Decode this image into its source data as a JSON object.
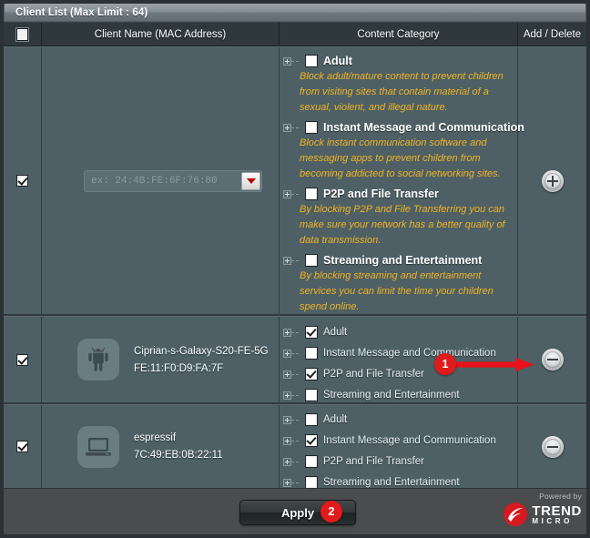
{
  "titlebar": {
    "title": "Client List (Max Limit : 64)"
  },
  "table": {
    "headers": {
      "select_all": "select-all-checkbox",
      "client_name": "Client Name (MAC Address)",
      "content_category": "Content Category",
      "add_delete": "Add / Delete"
    }
  },
  "new_row": {
    "row_checked": true,
    "mac_placeholder": "ex: 24:4B:FE:6F:76:80",
    "mac_value": "",
    "dropdown_icon": "caret-down-icon",
    "action_icon": "plus-circle-icon",
    "categories": [
      {
        "label": "Adult",
        "checked": false,
        "description": "Block adult/mature content to prevent children from visiting sites that contain material of a sexual, violent, and illegal nature."
      },
      {
        "label": "Instant Message and Communication",
        "checked": false,
        "description": "Block instant communication software and messaging apps to prevent children from becoming addicted to social networking sites."
      },
      {
        "label": "P2P and File Transfer",
        "checked": false,
        "description": "By blocking P2P and File Transferring you can make sure your network has a better quality of data transmission."
      },
      {
        "label": "Streaming and Entertainment",
        "checked": false,
        "description": "By blocking streaming and entertainment services you can limit the time your children spend online."
      }
    ]
  },
  "clients": [
    {
      "row_checked": true,
      "device_icon": "android-robot-icon",
      "name": "Ciprian-s-Galaxy-S20-FE-5G",
      "mac": "FE:11:F0:D9:FA:7F",
      "action_icon": "minus-circle-icon",
      "categories": [
        {
          "label": "Adult",
          "checked": true
        },
        {
          "label": "Instant Message and Communication",
          "checked": false
        },
        {
          "label": "P2P and File Transfer",
          "checked": true
        },
        {
          "label": "Streaming and Entertainment",
          "checked": false
        }
      ]
    },
    {
      "row_checked": true,
      "device_icon": "laptop-icon",
      "name": "espressif",
      "mac": "7C:49:EB:0B:22:11",
      "action_icon": "minus-circle-icon",
      "categories": [
        {
          "label": "Adult",
          "checked": false
        },
        {
          "label": "Instant Message and Communication",
          "checked": true
        },
        {
          "label": "P2P and File Transfer",
          "checked": false
        },
        {
          "label": "Streaming and Entertainment",
          "checked": false
        }
      ]
    }
  ],
  "footer": {
    "apply_label": "Apply",
    "powered_by": "Powered by",
    "brand_line1": "TREND",
    "brand_line2": "MICRO"
  },
  "annotations": [
    {
      "id": "1",
      "label": "1"
    },
    {
      "id": "2",
      "label": "2"
    }
  ],
  "colors": {
    "accent_orange": "#f0b323",
    "annotation_red": "#e01b1b",
    "row_background": "#4e6065",
    "header_background": "#2f383d",
    "brand_red": "#d71920"
  }
}
